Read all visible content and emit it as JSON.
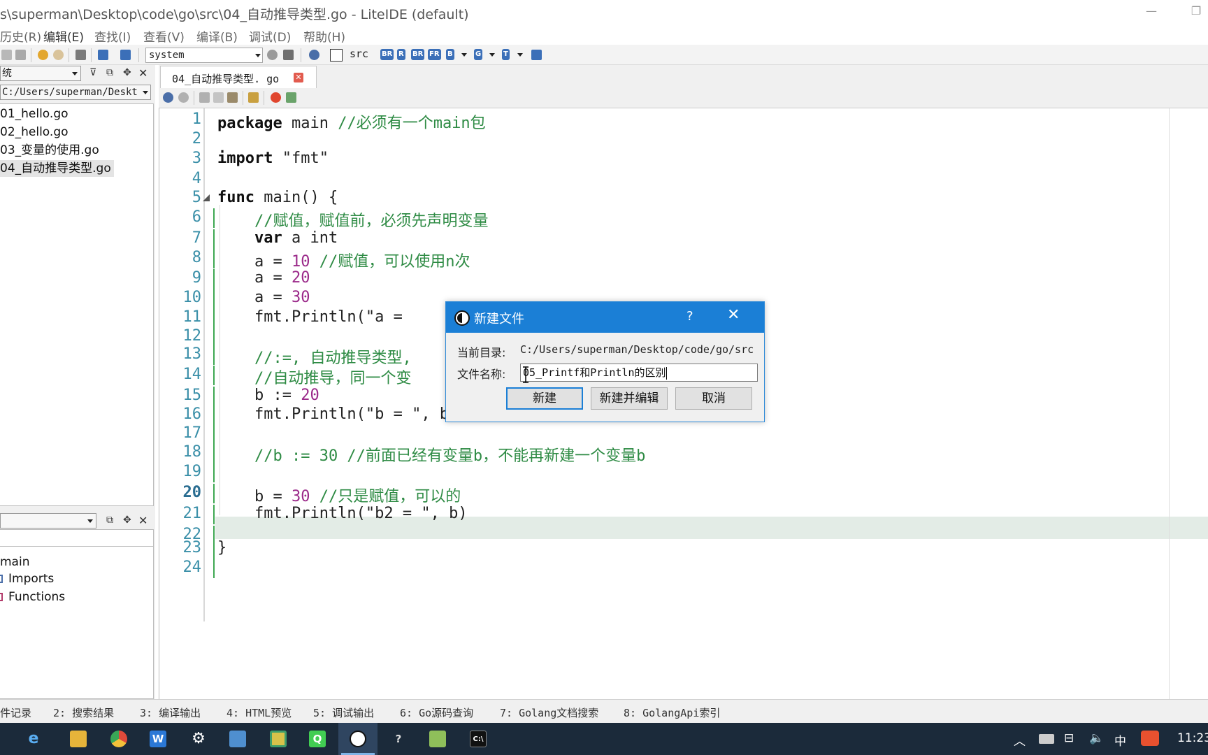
{
  "window": {
    "title": "s\\superman\\Desktop\\code\\go\\src\\04_自动推导类型.go - LiteIDE (default)",
    "minimize_glyph": "—",
    "restore_glyph": "❐"
  },
  "menu": [
    "历史(R)",
    "编辑(E)",
    "查找(I)",
    "查看(V)",
    "编译(B)",
    "调试(D)",
    "帮助(H)"
  ],
  "toolbar": {
    "env_combo": "system",
    "src_label": "src",
    "badges": [
      "BR",
      "R",
      "BR",
      "FR",
      "B",
      "G",
      "T"
    ]
  },
  "left_pane": {
    "view_combo": "统",
    "path_combo": "C:/Users/superman/Deskt",
    "files": [
      "01_hello.go",
      "02_hello.go",
      "03_变量的使用.go",
      "04_自动推导类型.go"
    ],
    "outline_combo": "",
    "outline": {
      "root": "main",
      "children": [
        "Imports",
        "Functions"
      ]
    }
  },
  "editor": {
    "tab_label": "04_自动推导类型. go",
    "tab_close": "✕",
    "current_line": 20,
    "lines": [
      {
        "n": "1",
        "segs": [
          [
            "kw",
            "package"
          ],
          [
            "",
            " main "
          ],
          [
            "cm",
            "//必须有一个main包"
          ]
        ]
      },
      {
        "n": "2",
        "segs": []
      },
      {
        "n": "3",
        "segs": [
          [
            "kw",
            "import"
          ],
          [
            "st",
            " \"fmt\""
          ]
        ]
      },
      {
        "n": "4",
        "segs": []
      },
      {
        "n": "5",
        "segs": [
          [
            "kw",
            "func"
          ],
          [
            "",
            " main() {"
          ]
        ]
      },
      {
        "n": "6",
        "segs": [
          [
            "",
            "    "
          ],
          [
            "cm",
            "//赋值，赋值前，必须先声明变量"
          ]
        ]
      },
      {
        "n": "7",
        "segs": [
          [
            "",
            "    "
          ],
          [
            "kw",
            "var"
          ],
          [
            "",
            " a int"
          ]
        ]
      },
      {
        "n": "8",
        "segs": [
          [
            "",
            "    a = "
          ],
          [
            "nm",
            "10"
          ],
          [
            "",
            " "
          ],
          [
            "cm",
            "//赋值，可以使用n次"
          ]
        ]
      },
      {
        "n": "9",
        "segs": [
          [
            "",
            "    a = "
          ],
          [
            "nm",
            "20"
          ]
        ]
      },
      {
        "n": "10",
        "segs": [
          [
            "",
            "    a = "
          ],
          [
            "nm",
            "30"
          ]
        ]
      },
      {
        "n": "11",
        "segs": [
          [
            "",
            "    fmt.Println(\"a = "
          ]
        ]
      },
      {
        "n": "12",
        "segs": []
      },
      {
        "n": "13",
        "segs": [
          [
            "",
            "    "
          ],
          [
            "cm",
            "//:=, 自动推导类型,"
          ]
        ]
      },
      {
        "n": "14",
        "segs": [
          [
            "",
            "    "
          ],
          [
            "cm",
            "//自动推导，同一个变"
          ]
        ]
      },
      {
        "n": "15",
        "segs": [
          [
            "",
            "    b := "
          ],
          [
            "nm",
            "20"
          ]
        ]
      },
      {
        "n": "16",
        "segs": [
          [
            "",
            "    fmt.Println(\"b = \", b)"
          ]
        ]
      },
      {
        "n": "17",
        "segs": []
      },
      {
        "n": "18",
        "segs": [
          [
            "",
            "    "
          ],
          [
            "cm",
            "//b := 30 //前面已经有变量b，不能再新建一个变量b"
          ]
        ]
      },
      {
        "n": "19",
        "segs": []
      },
      {
        "n": "20",
        "segs": [
          [
            "",
            "    b = "
          ],
          [
            "nm",
            "30"
          ],
          [
            "",
            " "
          ],
          [
            "cm",
            "//只是赋值，可以的"
          ]
        ]
      },
      {
        "n": "21",
        "segs": [
          [
            "",
            "    fmt.Println(\"b2 = \", b)"
          ]
        ]
      },
      {
        "n": "22",
        "segs": []
      },
      {
        "n": "23",
        "segs": [
          [
            "",
            "}"
          ]
        ]
      },
      {
        "n": "24",
        "segs": []
      }
    ]
  },
  "bottom_tabs": [
    "件记录",
    "2: 搜索结果",
    "3: 编译输出",
    "4: HTML预览",
    "5: 调试输出",
    "6: Go源码查询",
    "7: Golang文档搜索",
    "8: GolangApi索引"
  ],
  "dialog": {
    "title": "新建文件",
    "help": "?",
    "close": "✕",
    "dir_label": "当前目录:",
    "dir_value": "C:/Users/superman/Desktop/code/go/src",
    "name_label": "文件名称:",
    "name_value": "05_Printf和Println的区别",
    "buttons": {
      "create": "新建",
      "create_edit": "新建并编辑",
      "cancel": "取消"
    }
  },
  "taskbar": {
    "ime": "中",
    "clock": "11:23"
  }
}
